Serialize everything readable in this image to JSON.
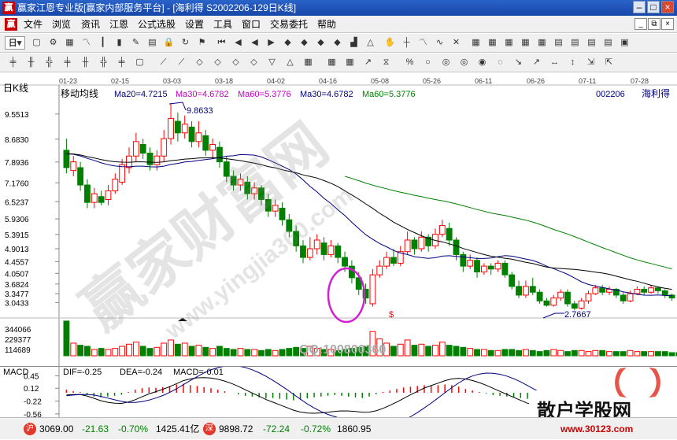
{
  "window": {
    "logo": "赢",
    "title": "赢家江恩专业版[赢家内部服务平台] - [海利得  S2002206-129日K线]",
    "controls": [
      "–",
      "□",
      "×"
    ]
  },
  "menu": {
    "logo": "赢",
    "items": [
      "文件",
      "浏览",
      "资讯",
      "江恩",
      "公式选股",
      "设置",
      "工具",
      "窗口",
      "交易委托",
      "帮助"
    ],
    "window_controls": [
      "_",
      "⧉",
      "×"
    ]
  },
  "toolbar1": {
    "period_label": "日",
    "icons": [
      "window-icon",
      "gear-icon",
      "grid-icon",
      "line-chart-icon",
      "candle-chart-icon",
      "bar-chart-icon",
      "pencil-icon",
      "page-icon",
      "lock-icon",
      "rotate-icon",
      "flag-icon",
      "first-icon",
      "prev-icon",
      "back-icon",
      "forward-icon",
      "diamond1-icon",
      "diamond2-icon",
      "diamond3-icon",
      "diamond4-icon",
      "step-icon",
      "triangle-icon",
      "hand-icon",
      "crosshair-icon",
      "zigzag-icon",
      "tilde-icon",
      "cross-icon",
      "calendar-icon",
      "cal2-icon",
      "cal3-icon",
      "cal4-icon",
      "cal5-icon",
      "page2-icon",
      "page3-icon",
      "page4-icon",
      "page5-icon",
      "disk-icon"
    ]
  },
  "toolbar2": {
    "icons": [
      "candle1-icon",
      "candle2-icon",
      "candle3-icon",
      "candle4-icon",
      "candle5-icon",
      "candle6-icon",
      "candle7-icon",
      "sq-icon",
      "gann1-icon",
      "gann2-icon",
      "gann3-icon",
      "gann4-icon",
      "gann5-icon",
      "gann6-icon",
      "gann7-icon",
      "gann8-icon",
      "grid2-icon",
      "grid3-icon",
      "grid4-icon",
      "chart1-icon",
      "chart2-icon",
      "pct-icon",
      "circle1-icon",
      "circle2-icon",
      "circle3-icon",
      "circle4-icon",
      "spiral-icon",
      "arrow1-icon",
      "arrow2-icon",
      "arrow3-icon",
      "arrow4-icon",
      "arrow5-icon",
      "arrow6-icon"
    ]
  },
  "chart": {
    "panel_label": "日K线",
    "indicator_label": "移动均线",
    "ma_labels": [
      {
        "text": "Ma20=4.7215",
        "color": "#000080"
      },
      {
        "text": "Ma30=4.6782",
        "color": "#c000c0"
      },
      {
        "text": "Ma60=5.3776",
        "color": "#c000c0"
      },
      {
        "text": "Ma30=4.6782",
        "color": "#000080"
      },
      {
        "text": "Ma60=5.3776",
        "color": "#008000"
      }
    ],
    "stock_code": "002206",
    "stock_name": "海利得",
    "dates": [
      "01-23",
      "02-15",
      "03-03",
      "03-18",
      "04-02",
      "04-16",
      "05-08",
      "05-26",
      "06-11",
      "06-26",
      "07-11",
      "07-28"
    ],
    "price_ticks": [
      "9.5513",
      "8.6830",
      "7.8936",
      "7.1760",
      "6.5237",
      "5.9306",
      "5.3915",
      "4.9013",
      "4.4557",
      "4.0507",
      "3.6824",
      "3.3477",
      "3.0433",
      "2.7667"
    ],
    "volume_ticks": [
      "344066",
      "229377",
      "114689"
    ],
    "high_marker": "9.8633",
    "low_marker": "2.7667",
    "dollar_sign": "$",
    "watermark_main": "赢家财富网",
    "watermark_url": "www.yingjia360.com",
    "watermark_qq": "QQ:100800360",
    "colors": {
      "up": "#ff0000",
      "down": "#008000",
      "ma20": "#000080",
      "ma30": "#000000",
      "ma60": "#008000",
      "circle": "#d020d0"
    },
    "candles": [
      {
        "o": 8.3,
        "c": 7.7,
        "h": 8.7,
        "l": 7.5
      },
      {
        "o": 7.6,
        "c": 7.9,
        "h": 8.1,
        "l": 7.4
      },
      {
        "o": 7.7,
        "c": 7.1,
        "h": 7.9,
        "l": 6.9
      },
      {
        "o": 7.1,
        "c": 6.5,
        "h": 7.3,
        "l": 6.3
      },
      {
        "o": 6.5,
        "c": 6.8,
        "h": 7.0,
        "l": 6.3
      },
      {
        "o": 6.7,
        "c": 6.5,
        "h": 6.9,
        "l": 6.4
      },
      {
        "o": 6.6,
        "c": 6.9,
        "h": 7.1,
        "l": 6.4
      },
      {
        "o": 6.9,
        "c": 7.3,
        "h": 7.5,
        "l": 6.8
      },
      {
        "o": 7.2,
        "c": 7.8,
        "h": 8.0,
        "l": 7.1
      },
      {
        "o": 7.7,
        "c": 8.1,
        "h": 8.4,
        "l": 7.5
      },
      {
        "o": 8.1,
        "c": 8.6,
        "h": 8.9,
        "l": 7.9
      },
      {
        "o": 8.5,
        "c": 8.2,
        "h": 8.7,
        "l": 8.0
      },
      {
        "o": 8.2,
        "c": 7.8,
        "h": 8.4,
        "l": 7.6
      },
      {
        "o": 7.8,
        "c": 8.1,
        "h": 8.3,
        "l": 7.6
      },
      {
        "o": 8.1,
        "c": 8.7,
        "h": 9.0,
        "l": 7.9
      },
      {
        "o": 8.7,
        "c": 9.4,
        "h": 9.9,
        "l": 8.5
      },
      {
        "o": 9.3,
        "c": 8.9,
        "h": 9.6,
        "l": 8.6
      },
      {
        "o": 8.9,
        "c": 9.2,
        "h": 9.5,
        "l": 8.7
      },
      {
        "o": 9.1,
        "c": 8.6,
        "h": 9.3,
        "l": 8.4
      },
      {
        "o": 8.6,
        "c": 8.9,
        "h": 9.3,
        "l": 8.4
      },
      {
        "o": 8.8,
        "c": 8.3,
        "h": 9.0,
        "l": 8.1
      },
      {
        "o": 8.3,
        "c": 8.5,
        "h": 8.7,
        "l": 8.0
      },
      {
        "o": 8.4,
        "c": 7.9,
        "h": 8.6,
        "l": 7.7
      },
      {
        "o": 7.9,
        "c": 7.4,
        "h": 8.1,
        "l": 7.2
      },
      {
        "o": 7.4,
        "c": 7.1,
        "h": 7.6,
        "l": 6.9
      },
      {
        "o": 7.1,
        "c": 7.3,
        "h": 7.5,
        "l": 6.9
      },
      {
        "o": 7.2,
        "c": 6.8,
        "h": 7.4,
        "l": 6.6
      },
      {
        "o": 6.8,
        "c": 7.0,
        "h": 7.2,
        "l": 6.6
      },
      {
        "o": 7.0,
        "c": 6.6,
        "h": 7.1,
        "l": 6.4
      },
      {
        "o": 6.6,
        "c": 6.2,
        "h": 6.8,
        "l": 6.0
      },
      {
        "o": 6.2,
        "c": 6.4,
        "h": 6.6,
        "l": 6.0
      },
      {
        "o": 6.3,
        "c": 5.9,
        "h": 6.5,
        "l": 5.7
      },
      {
        "o": 5.9,
        "c": 5.5,
        "h": 6.1,
        "l": 5.3
      },
      {
        "o": 5.5,
        "c": 5.0,
        "h": 5.7,
        "l": 4.8
      },
      {
        "o": 5.0,
        "c": 4.6,
        "h": 5.2,
        "l": 4.4
      },
      {
        "o": 4.6,
        "c": 4.9,
        "h": 5.3,
        "l": 4.5
      },
      {
        "o": 4.9,
        "c": 5.2,
        "h": 5.4,
        "l": 4.7
      },
      {
        "o": 5.1,
        "c": 4.7,
        "h": 5.3,
        "l": 4.5
      },
      {
        "o": 4.7,
        "c": 5.0,
        "h": 5.2,
        "l": 4.6
      },
      {
        "o": 5.0,
        "c": 4.6,
        "h": 5.1,
        "l": 4.4
      },
      {
        "o": 4.6,
        "c": 4.3,
        "h": 4.8,
        "l": 4.1
      },
      {
        "o": 4.3,
        "c": 3.9,
        "h": 4.5,
        "l": 3.7
      },
      {
        "o": 3.9,
        "c": 3.5,
        "h": 4.1,
        "l": 3.3
      },
      {
        "o": 3.5,
        "c": 3.2,
        "h": 3.7,
        "l": 3.0
      },
      {
        "o": 3.0,
        "c": 4.0,
        "h": 4.2,
        "l": 2.9
      },
      {
        "o": 4.0,
        "c": 4.3,
        "h": 4.5,
        "l": 3.9
      },
      {
        "o": 4.3,
        "c": 4.6,
        "h": 4.8,
        "l": 4.2
      },
      {
        "o": 4.6,
        "c": 4.4,
        "h": 4.9,
        "l": 4.3
      },
      {
        "o": 4.4,
        "c": 4.8,
        "h": 5.0,
        "l": 4.3
      },
      {
        "o": 4.8,
        "c": 5.2,
        "h": 5.5,
        "l": 4.7
      },
      {
        "o": 5.2,
        "c": 4.9,
        "h": 5.3,
        "l": 4.7
      },
      {
        "o": 4.9,
        "c": 5.3,
        "h": 5.5,
        "l": 4.8
      },
      {
        "o": 5.3,
        "c": 5.0,
        "h": 5.4,
        "l": 4.8
      },
      {
        "o": 5.0,
        "c": 5.4,
        "h": 5.6,
        "l": 4.9
      },
      {
        "o": 5.4,
        "c": 5.7,
        "h": 5.9,
        "l": 5.3
      },
      {
        "o": 5.6,
        "c": 5.2,
        "h": 5.8,
        "l": 5.0
      },
      {
        "o": 5.2,
        "c": 4.7,
        "h": 5.3,
        "l": 4.5
      },
      {
        "o": 4.7,
        "c": 4.3,
        "h": 4.8,
        "l": 4.1
      },
      {
        "o": 4.3,
        "c": 4.5,
        "h": 4.7,
        "l": 4.2
      },
      {
        "o": 4.5,
        "c": 4.1,
        "h": 4.6,
        "l": 3.9
      },
      {
        "o": 4.1,
        "c": 4.3,
        "h": 4.4,
        "l": 4.0
      },
      {
        "o": 4.3,
        "c": 4.2,
        "h": 4.4,
        "l": 4.0
      },
      {
        "o": 4.2,
        "c": 4.4,
        "h": 4.5,
        "l": 4.1
      },
      {
        "o": 4.4,
        "c": 4.0,
        "h": 4.5,
        "l": 3.9
      },
      {
        "o": 4.0,
        "c": 3.6,
        "h": 4.1,
        "l": 3.5
      },
      {
        "o": 3.6,
        "c": 3.3,
        "h": 3.8,
        "l": 3.2
      },
      {
        "o": 3.3,
        "c": 3.6,
        "h": 3.8,
        "l": 3.2
      },
      {
        "o": 3.6,
        "c": 3.4,
        "h": 3.9,
        "l": 3.3
      },
      {
        "o": 3.4,
        "c": 3.1,
        "h": 3.5,
        "l": 3.0
      },
      {
        "o": 3.1,
        "c": 2.95,
        "h": 3.2,
        "l": 2.9
      },
      {
        "o": 2.95,
        "c": 3.2,
        "h": 3.3,
        "l": 2.9
      },
      {
        "o": 3.2,
        "c": 3.4,
        "h": 3.5,
        "l": 3.1
      },
      {
        "o": 3.4,
        "c": 3.0,
        "h": 3.5,
        "l": 2.9
      },
      {
        "o": 3.0,
        "c": 2.85,
        "h": 3.1,
        "l": 2.77
      },
      {
        "o": 2.85,
        "c": 3.1,
        "h": 3.2,
        "l": 2.8
      },
      {
        "o": 3.1,
        "c": 3.35,
        "h": 3.45,
        "l": 3.0
      },
      {
        "o": 3.35,
        "c": 3.55,
        "h": 3.65,
        "l": 3.3
      },
      {
        "o": 3.55,
        "c": 3.4,
        "h": 3.65,
        "l": 3.3
      },
      {
        "o": 3.4,
        "c": 3.5,
        "h": 3.6,
        "l": 3.3
      },
      {
        "o": 3.5,
        "c": 3.3,
        "h": 3.55,
        "l": 3.2
      },
      {
        "o": 3.3,
        "c": 3.1,
        "h": 3.4,
        "l": 3.0
      },
      {
        "o": 3.1,
        "c": 3.35,
        "h": 3.45,
        "l": 3.05
      },
      {
        "o": 3.35,
        "c": 3.5,
        "h": 3.6,
        "l": 3.3
      },
      {
        "o": 3.5,
        "c": 3.4,
        "h": 3.6,
        "l": 3.3
      },
      {
        "o": 3.4,
        "c": 3.55,
        "h": 3.65,
        "l": 3.35
      },
      {
        "o": 3.55,
        "c": 3.45,
        "h": 3.6,
        "l": 3.35
      },
      {
        "o": 3.45,
        "c": 3.3,
        "h": 3.5,
        "l": 3.2
      },
      {
        "o": 3.3,
        "c": 3.2,
        "h": 3.35,
        "l": 3.1
      }
    ],
    "volumes": [
      330,
      120,
      100,
      90,
      60,
      70,
      60,
      70,
      90,
      110,
      130,
      90,
      70,
      80,
      120,
      150,
      110,
      120,
      90,
      100,
      80,
      70,
      90,
      70,
      60,
      70,
      60,
      60,
      50,
      60,
      50,
      60,
      70,
      80,
      70,
      90,
      70,
      60,
      60,
      50,
      60,
      70,
      80,
      90,
      230,
      160,
      120,
      90,
      110,
      150,
      100,
      110,
      90,
      100,
      130,
      100,
      90,
      80,
      70,
      60,
      60,
      50,
      50,
      60,
      60,
      50,
      60,
      50,
      40,
      50,
      60,
      50,
      40,
      50,
      50,
      40,
      50,
      50,
      40,
      40,
      40,
      50,
      40,
      40,
      40,
      40,
      40,
      30,
      30
    ]
  },
  "macd": {
    "title": "MACD",
    "dif_label": "DIF=-0.25",
    "dea_label": "DEA=-0.24",
    "macd_label": "MACD=-0.01",
    "ticks": [
      "0.45",
      "0.12",
      "-0.22",
      "-0.56"
    ],
    "bars": [
      0.08,
      0.04,
      0.02,
      -0.05,
      -0.1,
      -0.12,
      -0.1,
      -0.08,
      -0.05,
      0.02,
      0.08,
      0.12,
      0.14,
      0.13,
      0.15,
      0.18,
      0.22,
      0.24,
      0.2,
      0.18,
      0.15,
      0.12,
      0.08,
      0.04,
      0.0,
      -0.04,
      -0.08,
      -0.1,
      -0.12,
      -0.15,
      -0.14,
      -0.16,
      -0.18,
      -0.2,
      -0.18,
      -0.15,
      -0.12,
      -0.1,
      -0.08,
      -0.06,
      -0.08,
      -0.1,
      -0.12,
      -0.14,
      -0.1,
      -0.04,
      0.02,
      0.06,
      0.1,
      0.14,
      0.16,
      0.18,
      0.2,
      0.18,
      0.2,
      0.22,
      0.2,
      0.16,
      0.1,
      0.06,
      0.02,
      -0.02,
      -0.06,
      -0.08,
      -0.1,
      -0.12,
      -0.14,
      -0.16,
      -0.12,
      -0.1,
      -0.08,
      -0.06,
      -0.04,
      -0.02,
      0.0,
      0.02,
      0.04,
      0.06,
      0.05,
      0.04,
      0.02,
      0.0,
      -0.02,
      -0.03,
      -0.02,
      -0.01,
      0.0,
      -0.01,
      -0.01
    ]
  },
  "corner_badge": {
    "site_name": "散户学股网",
    "site_url": "www.30123.com"
  },
  "status": {
    "idx1_logo": "沪",
    "idx1_value": "3069.00",
    "idx1_change": "-21.63",
    "idx1_pct": "-0.70%",
    "idx1_amount": "1425.41亿",
    "idx2_logo": "深",
    "idx2_value": "9898.72",
    "idx2_change": "-72.24",
    "idx2_pct": "-0.72%",
    "idx2_amount": "1860.95"
  }
}
